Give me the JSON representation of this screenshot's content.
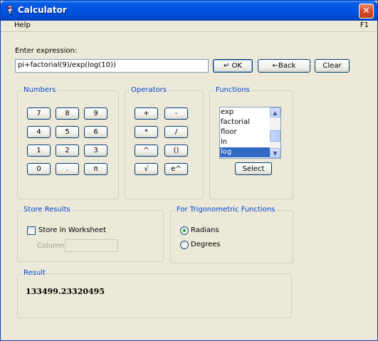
{
  "window": {
    "title": "Calculator",
    "close_glyph": "✕"
  },
  "menu": {
    "help": "Help",
    "shortcut": "F1"
  },
  "expression": {
    "prompt": "Enter expression:",
    "value": "pi+factorial(9)/exp(log(10))",
    "ok_label": "↵ OK",
    "back_label": "←Back",
    "clear_label": "Clear"
  },
  "numbers": {
    "title": "Numbers",
    "keys": [
      "7",
      "8",
      "9",
      "4",
      "5",
      "6",
      "1",
      "2",
      "3",
      "0",
      ".",
      "π"
    ]
  },
  "operators": {
    "title": "Operators",
    "keys": [
      "+",
      "-",
      "*",
      "/",
      "^",
      "()",
      "√",
      "e^"
    ]
  },
  "functions": {
    "title": "Functions",
    "items": [
      "exp",
      "factorial",
      "floor",
      "ln",
      "log"
    ],
    "selected": "log",
    "select_label": "Select"
  },
  "store": {
    "title": "Store Results",
    "checkbox_label": "Store in Worksheet",
    "checked": false,
    "column_label": "Column:",
    "column_value": ""
  },
  "trig": {
    "title": "For Trigonometric Functions",
    "options": [
      "Radians",
      "Degrees"
    ],
    "selected": "Radians"
  },
  "result": {
    "title": "Result",
    "value": "133499.23320495"
  },
  "colors": {
    "title_bar": "#0054e3",
    "group_title": "#0046d5",
    "selection": "#316ac5",
    "window_bg": "#ece9d8"
  }
}
